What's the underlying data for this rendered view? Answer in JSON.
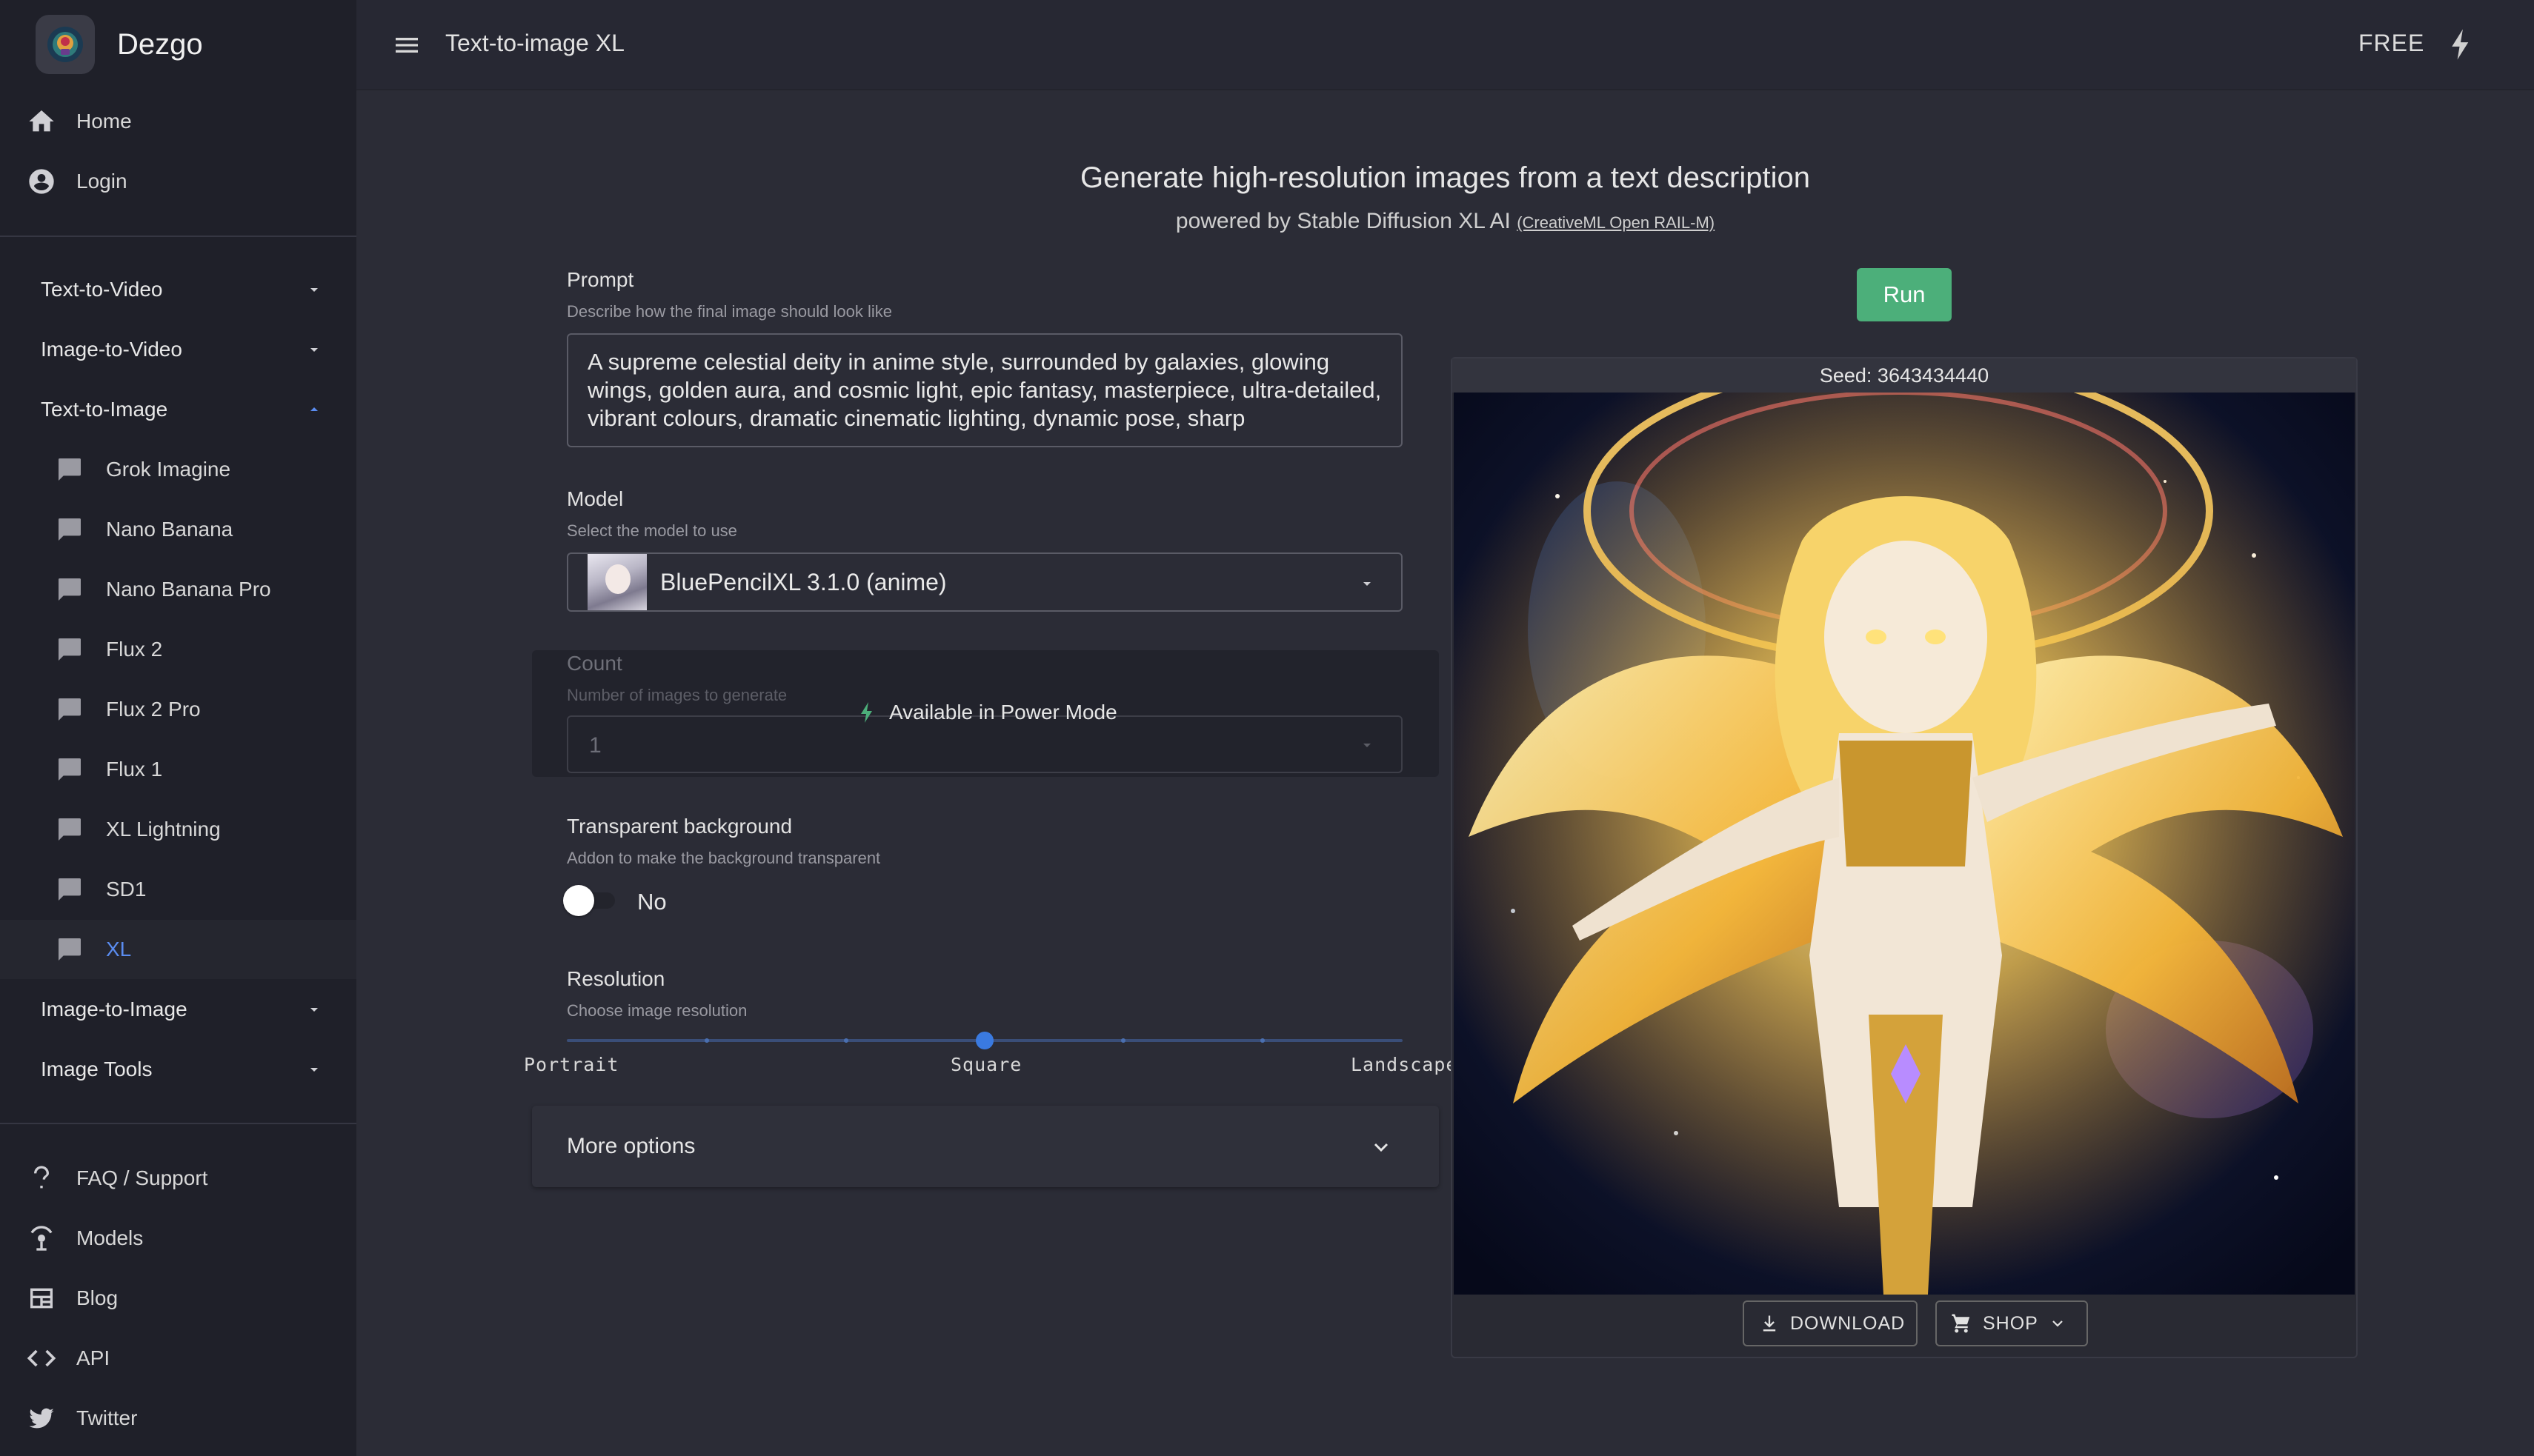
{
  "app": {
    "name": "Dezgo"
  },
  "topbar": {
    "title": "Text-to-image XL",
    "plan": "FREE"
  },
  "sidebar": {
    "top": [
      {
        "label": "Home",
        "icon": "home-icon"
      },
      {
        "label": "Login",
        "icon": "account-icon"
      }
    ],
    "groups": {
      "text_to_video": "Text-to-Video",
      "image_to_video": "Image-to-Video",
      "text_to_image": "Text-to-Image",
      "image_to_image": "Image-to-Image",
      "image_tools": "Image Tools"
    },
    "text_to_image_items": [
      {
        "label": "Grok Imagine"
      },
      {
        "label": "Nano Banana"
      },
      {
        "label": "Nano Banana Pro"
      },
      {
        "label": "Flux 2"
      },
      {
        "label": "Flux 2 Pro"
      },
      {
        "label": "Flux 1"
      },
      {
        "label": "XL Lightning"
      },
      {
        "label": "SD1"
      },
      {
        "label": "XL",
        "active": true
      }
    ],
    "bottom": [
      {
        "label": "FAQ / Support",
        "icon": "question-icon"
      },
      {
        "label": "Models",
        "icon": "models-icon"
      },
      {
        "label": "Blog",
        "icon": "blog-icon"
      },
      {
        "label": "API",
        "icon": "code-icon"
      },
      {
        "label": "Twitter",
        "icon": "twitter-icon"
      }
    ]
  },
  "header": {
    "title": "Generate high-resolution images from a text description",
    "subtitle": "powered by Stable Diffusion XL AI",
    "license_link": "(CreativeML Open RAIL-M)"
  },
  "form": {
    "prompt": {
      "label": "Prompt",
      "help": "Describe how the final image should look like",
      "value": "A supreme celestial deity in anime style, surrounded by galaxies, glowing wings, golden aura, and cosmic light, epic fantasy, masterpiece, ultra-detailed, vibrant colours, dramatic cinematic lighting, dynamic pose, sharp"
    },
    "model": {
      "label": "Model",
      "help": "Select the model to use",
      "value": "BluePencilXL 3.1.0 (anime)"
    },
    "count": {
      "label": "Count",
      "help": "Number of images to generate",
      "value": "1",
      "locked_note": "Available in Power Mode"
    },
    "transparent": {
      "label": "Transparent background",
      "help": "Addon to make the background transparent",
      "state": "No",
      "on": false
    },
    "resolution": {
      "label": "Resolution",
      "help": "Choose image resolution",
      "labels": [
        "Portrait",
        "Square",
        "Landscape"
      ],
      "value": "Square",
      "position_fraction": 0.5
    },
    "more_options": "More options",
    "run_label": "Run"
  },
  "result": {
    "seed_text": "Seed: 3643434440",
    "download_label": "DOWNLOAD",
    "shop_label": "SHOP"
  },
  "colors": {
    "accent_green": "#4caf7a",
    "active_blue": "#5a8cf0",
    "slider_blue": "#3a7ae0",
    "power_bolt": "#4caf7a"
  }
}
